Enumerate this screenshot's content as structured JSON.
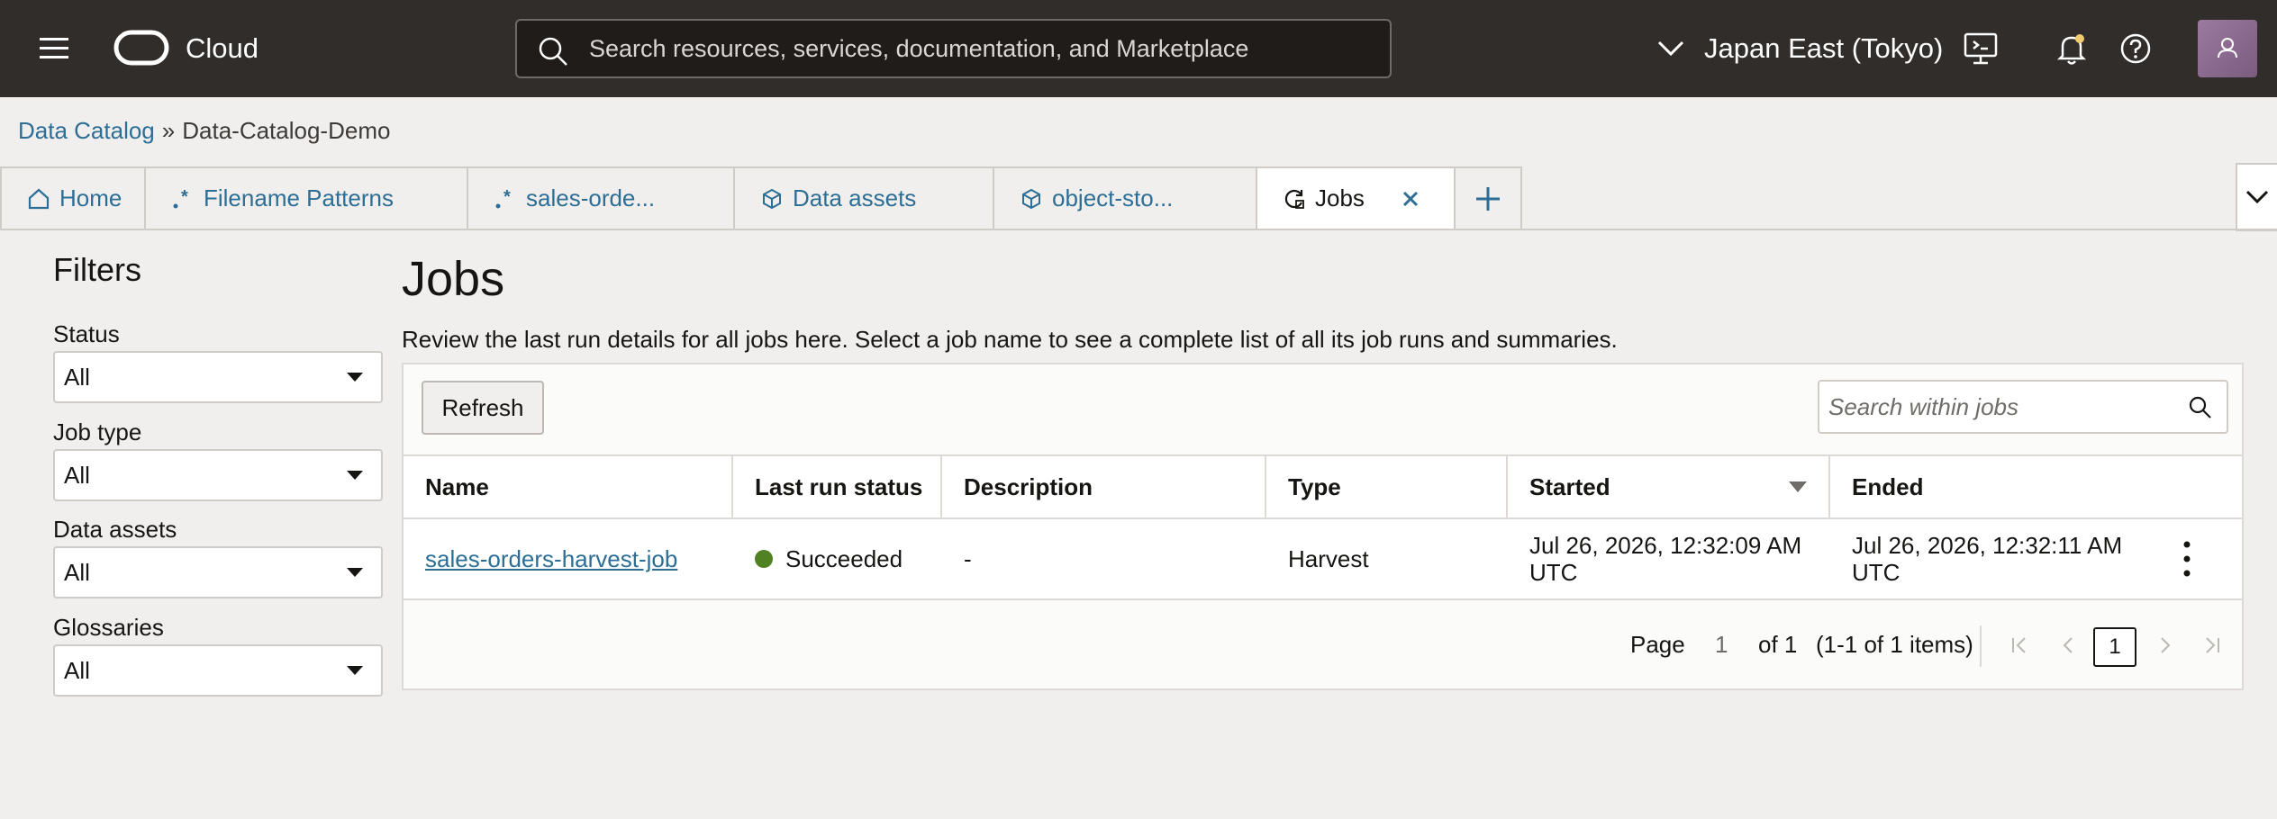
{
  "header": {
    "brand": "Cloud",
    "search_placeholder": "Search resources, services, documentation, and Marketplace",
    "region": "Japan East (Tokyo)"
  },
  "breadcrumb": {
    "parent": "Data Catalog",
    "separator": "»",
    "current": "Data-Catalog-Demo"
  },
  "tabs": [
    {
      "label": "Home",
      "icon": "home-icon"
    },
    {
      "label": "Filename Patterns",
      "icon": "regex-icon"
    },
    {
      "label": "sales-orde...",
      "icon": "regex-icon"
    },
    {
      "label": "Data assets",
      "icon": "cube-icon"
    },
    {
      "label": "object-sto...",
      "icon": "cube-icon"
    },
    {
      "label": "Jobs",
      "icon": "refresh-icon",
      "active": true
    }
  ],
  "filters": {
    "title": "Filters",
    "groups": [
      {
        "label": "Status",
        "value": "All"
      },
      {
        "label": "Job type",
        "value": "All"
      },
      {
        "label": "Data assets",
        "value": "All"
      },
      {
        "label": "Glossaries",
        "value": "All"
      }
    ]
  },
  "main": {
    "title": "Jobs",
    "description": "Review the last run details for all jobs here. Select a job name to see a complete list of all its job runs and summaries.",
    "refresh_label": "Refresh",
    "search_placeholder": "Search within jobs"
  },
  "table": {
    "columns": [
      "Name",
      "Last run status",
      "Description",
      "Type",
      "Started",
      "Ended"
    ],
    "rows": [
      {
        "name": "sales-orders-harvest-job",
        "status": "Succeeded",
        "description": "-",
        "type": "Harvest",
        "started_line1": "Jul 26, 2026, 12:32:09 AM",
        "started_line2": "UTC",
        "ended_line1": "Jul 26, 2026, 12:32:11 AM",
        "ended_line2": "UTC"
      }
    ]
  },
  "pagination": {
    "page_label": "Page",
    "page_value": "1",
    "of_label": "of 1",
    "items_label": "(1-1 of 1 items)",
    "current_page": "1"
  },
  "colors": {
    "header_bg": "#312d2a",
    "link": "#2c6e95",
    "success": "#508223"
  }
}
